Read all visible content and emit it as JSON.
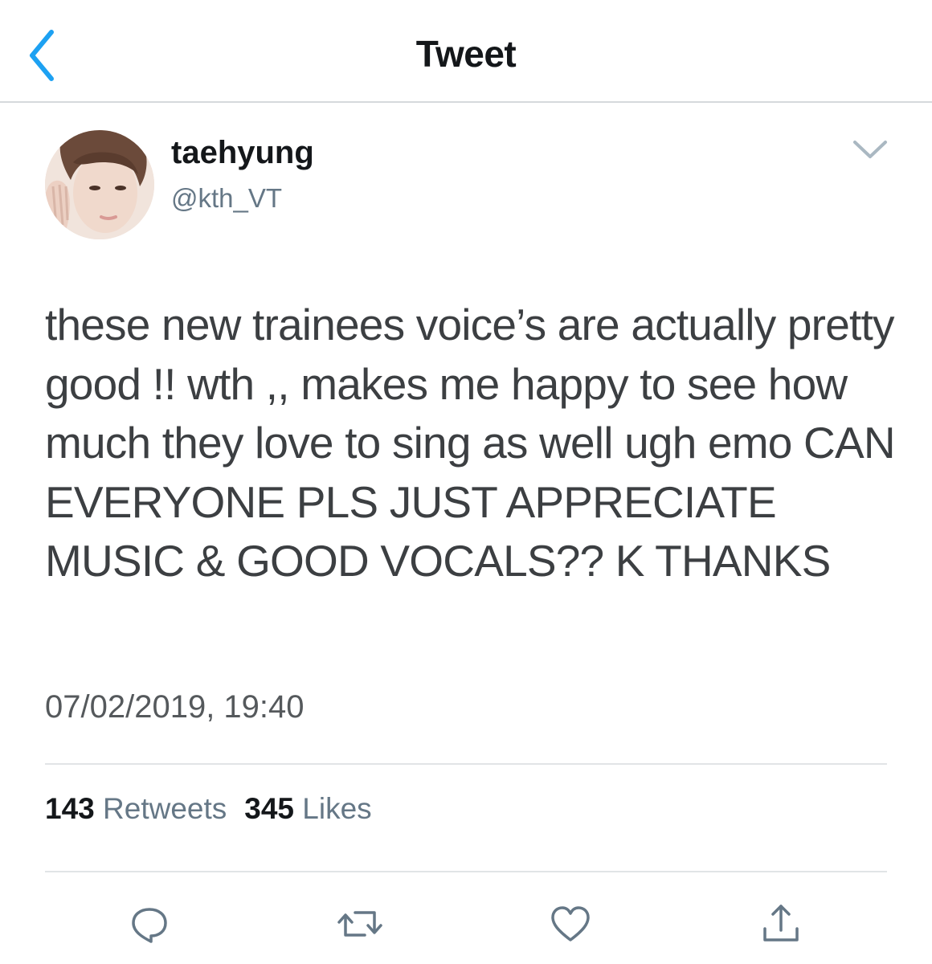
{
  "header": {
    "title": "Tweet",
    "back_icon": "chevron-left-icon",
    "accent_color": "#1da1f2"
  },
  "tweet": {
    "author": {
      "display_name": "taehyung",
      "handle": "@kth_VT",
      "avatar_icon": "avatar-photo"
    },
    "menu_icon": "chevron-down-icon",
    "text": "these new trainees voice’s are actually pretty good !! wth ,, makes me happy to see how much they love to sing as well ugh emo CAN EVERYONE PLS JUST APPRECIATE MUSIC & GOOD VOCALS?? K THANKS",
    "timestamp": "07/02/2019, 19:40"
  },
  "stats": {
    "retweets_count": "143",
    "retweets_label": "Retweets",
    "likes_count": "345",
    "likes_label": "Likes"
  },
  "actions": [
    {
      "icon": "reply-icon"
    },
    {
      "icon": "retweet-icon"
    },
    {
      "icon": "like-icon"
    },
    {
      "icon": "share-icon"
    }
  ]
}
